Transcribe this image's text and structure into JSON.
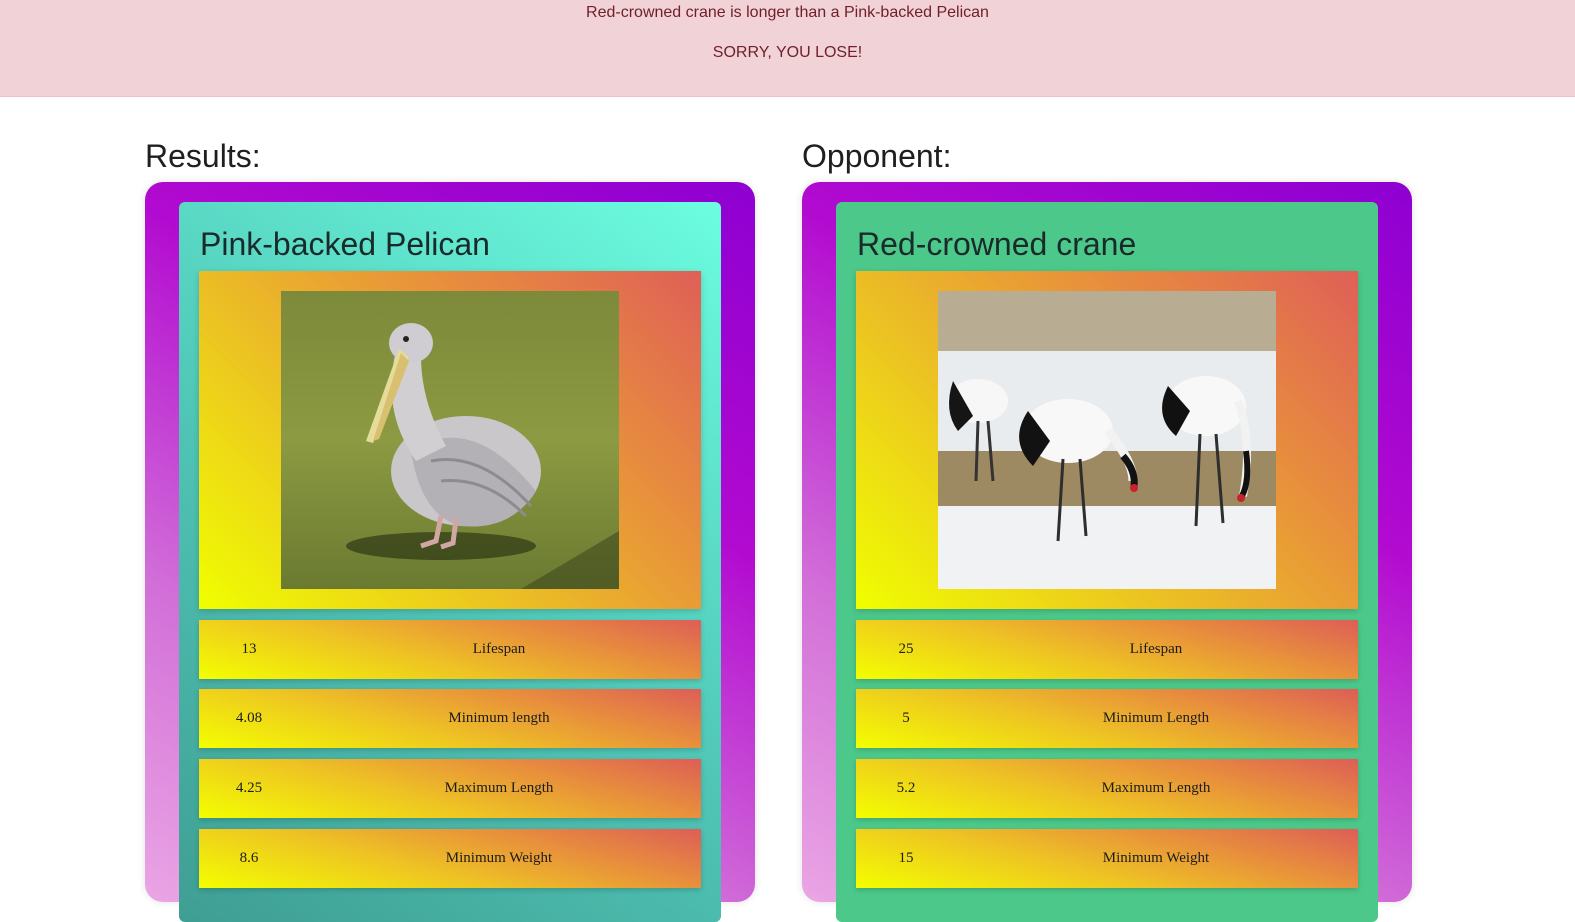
{
  "result_banner": {
    "message": "Red-crowned crane is longer than a Pink-backed Pelican",
    "outcome": "SORRY, YOU LOSE!"
  },
  "player": {
    "heading": "Results:",
    "card": {
      "name": "Pink-backed Pelican",
      "image": "pink-backed-pelican-photo",
      "stats": [
        {
          "value": "13",
          "label": "Lifespan"
        },
        {
          "value": "4.08",
          "label": "Minimum length"
        },
        {
          "value": "4.25",
          "label": "Maximum Length"
        },
        {
          "value": "8.6",
          "label": "Minimum Weight"
        }
      ]
    }
  },
  "opponent": {
    "heading": "Opponent:",
    "card": {
      "name": "Red-crowned crane",
      "image": "red-crowned-crane-photo",
      "stats": [
        {
          "value": "25",
          "label": "Lifespan"
        },
        {
          "value": "5",
          "label": "Minimum Length"
        },
        {
          "value": "5.2",
          "label": "Maximum Length"
        },
        {
          "value": "15",
          "label": "Minimum Weight"
        }
      ]
    }
  },
  "colors": {
    "alert_bg": "#f1d2d7",
    "alert_text": "#6e1f2a",
    "outer_card": "#b20ad0",
    "player_inner": "#4fc4b5",
    "opponent_inner": "#4cc98a",
    "stat_gradient_start": "#f3ff00",
    "stat_gradient_end": "#dd5e57"
  }
}
